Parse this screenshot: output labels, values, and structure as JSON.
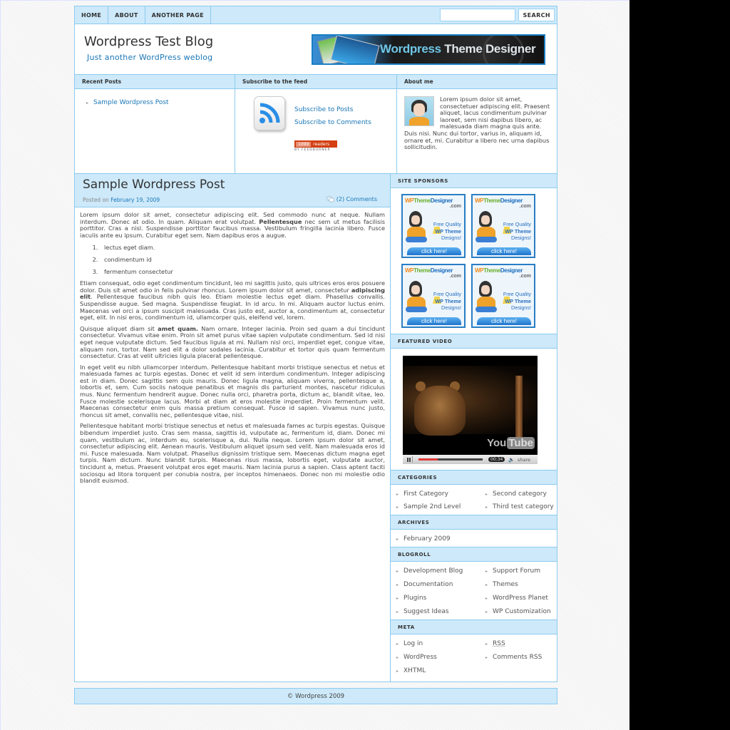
{
  "nav": {
    "links": [
      "HOME",
      "ABOUT",
      "ANOTHER PAGE"
    ],
    "search_placeholder": "",
    "search_value": "",
    "search_button": "SEARCH"
  },
  "header": {
    "title": "Wordpress Test Blog",
    "tagline": "Just another WordPress weblog",
    "banner": {
      "part1": "Wordpress",
      "part2": "Theme Designer"
    }
  },
  "top_widgets": {
    "recent_posts": {
      "title": "Recent Posts",
      "items": [
        "Sample Wordpress Post"
      ]
    },
    "subscribe": {
      "title": "Subscribe to the feed",
      "links": [
        "Subscribe to Posts",
        "Subscribe to Comments"
      ],
      "feedburner": {
        "count": "1099",
        "label": "readers",
        "by": "BY FEEDBURNER"
      }
    },
    "about": {
      "title": "About me",
      "text": "Lorem ipsum dolor sit amet, consectetuer adipiscing elit. Praesent aliquet, lacus condimentum pulvinar laoreet, sem nisi dapibus libero, ac malesuada diam magna quis ante. Duis nisi. Nunc dui tortor, varius in, aliquam id, ornare et, mi. Curabitur a libero nec urna dapibus sollicitudin."
    }
  },
  "post": {
    "title": "Sample Wordpress Post",
    "posted_on_label": "Posted on",
    "date": "February 19, 2009",
    "comments": "(2) Comments",
    "p1": {
      "a": "Lorem ipsum dolor sit amet, consectetur adipiscing elit. Sed commodo nunc at neque. Nullam interdum. Donec at odio. In quam. Aliquam erat volutpat. ",
      "bold": "Pellentesque",
      "b": " nec sem ut metus facilisis porttitor. Cras a nisl. Suspendisse porttitor faucibus massa. Vestibulum fringilla lacinia libero. Fusce iaculis ante eu ipsum. Curabitur eget sem. Nam dapibus eros a augue."
    },
    "list": [
      "lectus eget diam.",
      "condimentum id",
      "fermentum consectetur"
    ],
    "p2": {
      "a": "Etiam consequat, odio eget condimentum tincidunt, leo mi sagittis justo, quis ultrices eros eros posuere dolor. Duis sit amet odio in felis pulvinar rhoncus. Lorem ipsum dolor sit amet, consectetur ",
      "bold": "adipiscing elit",
      "b": ". Pellentesque faucibus nibh quis leo. Etiam molestie lectus eget diam. Phasellus convallis. Suspendisse augue. Sed magna. Suspendisse feugiat. In id arcu. In mi. Aliquam auctor luctus enim. Maecenas vel orci a ipsum suscipit malesuada. Cras justo est, auctor a, condimentum at, consectetur eget, elit. In nisi eros, condimentum id, ullamcorper quis, eleifend vel, lorem."
    },
    "p3": {
      "a": "Quisque aliquet diam sit ",
      "bold": "amet quam.",
      "b": " Nam ornare. Integer lacinia. Proin sed quam a dui tincidunt consectetur. Vivamus vitae enim. Proin sit amet purus vitae sapien vulputate condimentum. Sed id nisi eget neque vulputate dictum. Sed faucibus ligula at mi. Nullam nisl orci, imperdiet eget, congue vitae, aliquam non, tortor. Nam sed elit a dolor sodales lacinia. Curabitur et tortor quis quam fermentum consectetur. Cras at velit ultricies ligula placerat pellentesque."
    },
    "p4": "In eget velit eu nibh ullamcorper interdum. Pellentesque habitant morbi tristique senectus et netus et malesuada fames ac turpis egestas. Donec et velit id sem interdum condimentum. Integer adipiscing est in diam. Donec sagittis sem quis mauris. Donec ligula magna, aliquam viverra, pellentesque a, lobortis et, sem. Cum sociis natoque penatibus et magnis dis parturient montes, nascetur ridiculus mus. Nunc fermentum hendrerit augue. Donec nulla orci, pharetra porta, dictum ac, blandit vitae, leo. Fusce molestie scelerisque lacus. Morbi at diam at eros molestie imperdiet. Proin fermentum velit. Maecenas consectetur enim quis massa pretium consequat. Fusce id sapien. Vivamus nunc justo, rhoncus sit amet, convallis nec, pellentesque vitae, nisl.",
    "p5": "Pellentesque habitant morbi tristique senectus et netus et malesuada fames ac turpis egestas. Quisque bibendum imperdiet justo. Cras sem massa, sagittis id, vulputate ac, fermentum id, diam. Donec mi quam, vestibulum ac, interdum eu, scelerisque a, dui. Nulla neque. Lorem ipsum dolor sit amet, consectetur adipiscing elit. Aenean mauris. Vestibulum aliquet ipsum sed velit. Nam malesuada eros id mi. Fusce malesuada. Nam volutpat. Phasellus dignissim tristique sem. Maecenas dictum magna eget turpis. Nam dictum. Nunc blandit turpis. Maecenas risus massa, lobortis eget, vulputate auctor, tincidunt a, metus. Praesent volutpat eros eget mauris. Nam lacinia purus a sapien. Class aptent taciti sociosqu ad litora torquent per conubia nostra, per inceptos himenaeos. Donec non mi molestie odio blandit euismod."
  },
  "sidebar": {
    "sponsors": {
      "title": "SITE SPONSORS",
      "ad": {
        "brand_a": "WP",
        "brand_b": "Theme",
        "brand_c": "Designer",
        "dotcom": ".com",
        "line1": "Free Quality",
        "line2": "WP Theme",
        "line3": "Designs!",
        "cta": "click here!"
      }
    },
    "video": {
      "title": "FEATURED VIDEO",
      "time": "00:34",
      "progress": 0.3,
      "share": "share",
      "brand_you": "You",
      "brand_tube": "Tube"
    },
    "categories": {
      "title": "CATEGORIES",
      "items": [
        "First Category",
        "Second category",
        "Sample 2nd Level",
        "Third test category"
      ]
    },
    "archives": {
      "title": "ARCHIVES",
      "items": [
        "February 2009"
      ]
    },
    "blogroll": {
      "title": "BLOGROLL",
      "items": [
        "Development Blog",
        "Support Forum",
        "Documentation",
        "Themes",
        "Plugins",
        "WordPress Planet",
        "Suggest Ideas",
        "WP Customization"
      ]
    },
    "meta": {
      "title": "META",
      "items": [
        "Log in",
        "RSS",
        "WordPress",
        "Comments RSS",
        "XHTML"
      ]
    }
  },
  "footer": {
    "text": "© Wordpress 2009"
  },
  "colors": {
    "accent_blue": "#1a77b8",
    "bar_blue": "#cde9fa",
    "border_blue": "#8ccbef"
  }
}
